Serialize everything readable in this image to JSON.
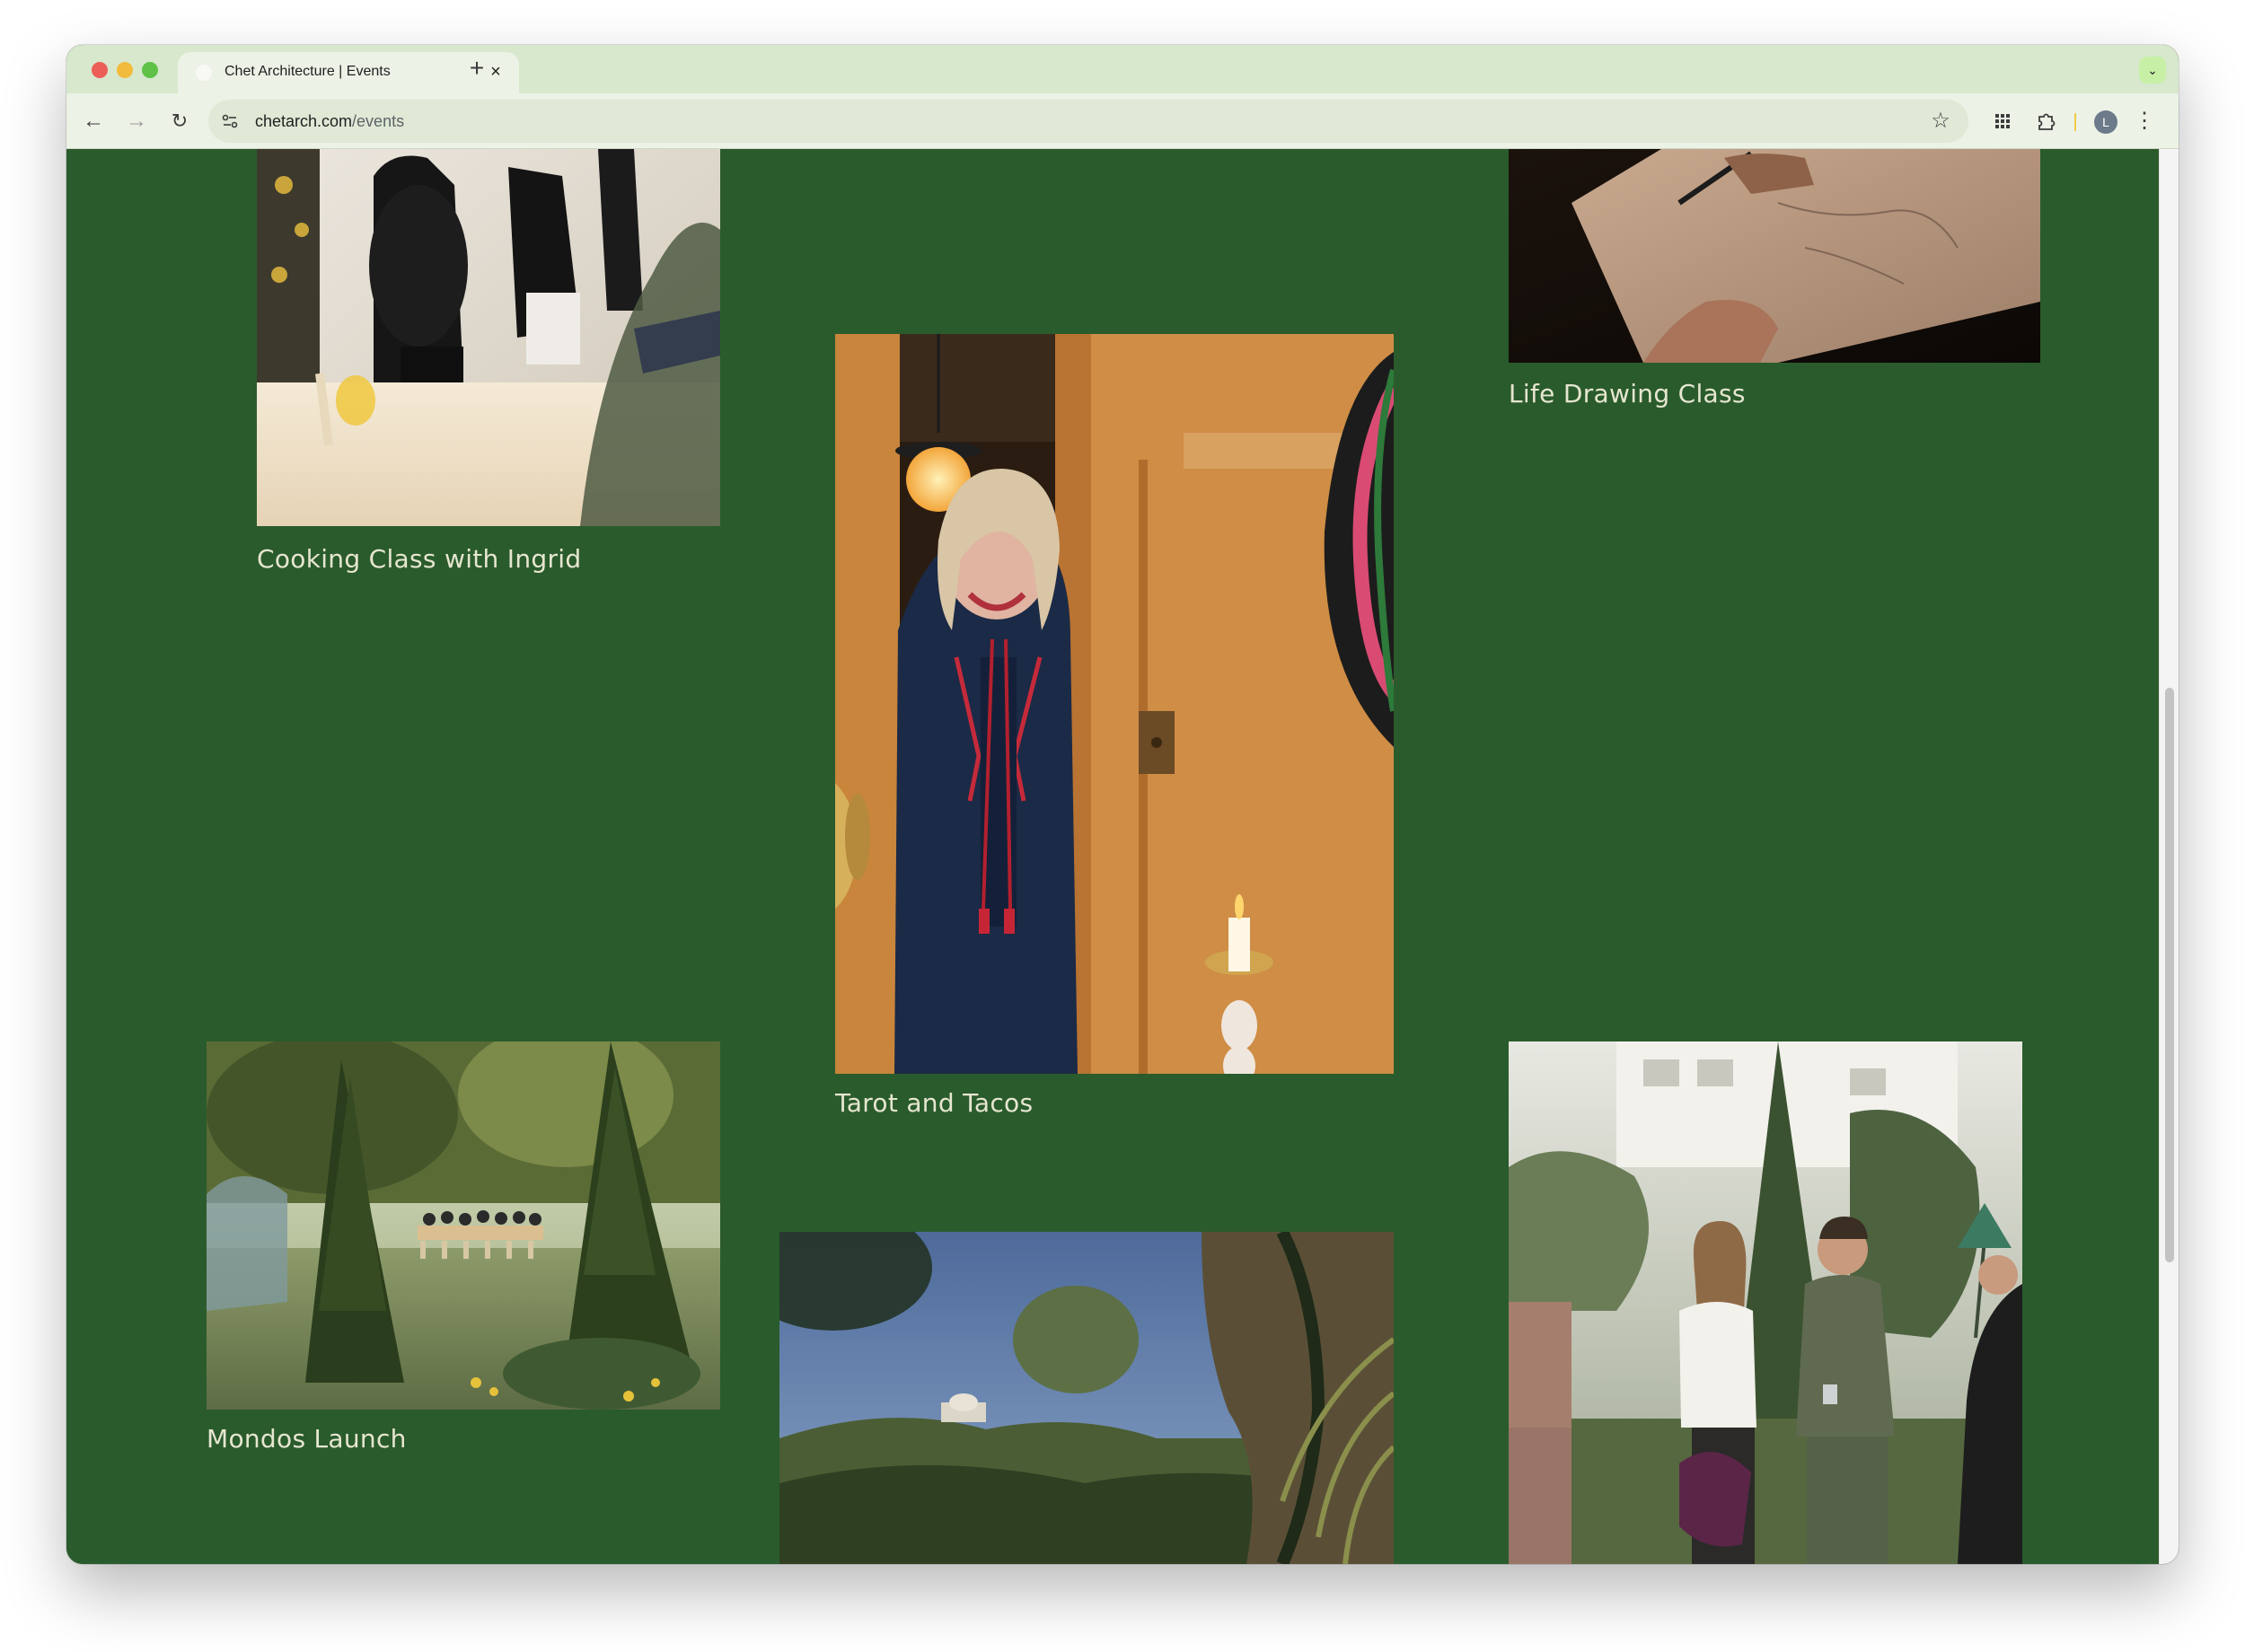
{
  "browser": {
    "tab_title": "Chet Architecture | Events",
    "url_host": "chetarch.com",
    "url_path": "/events",
    "avatar_initial": "L"
  },
  "icons": {
    "back": "back-arrow-icon",
    "forward": "forward-arrow-icon",
    "reload": "reload-icon",
    "site_info": "site-info-icon",
    "bookmark": "star-icon",
    "apps": "apps-grid-icon",
    "extensions": "puzzle-icon",
    "menu": "kebab-menu-icon",
    "close": "close-icon",
    "new_tab": "plus-icon",
    "tab_search": "chevron-down-icon"
  },
  "colors": {
    "page_background": "#2a5b2c",
    "caption_text": "#e6e6d0",
    "tab_strip": "#d7e8cd"
  },
  "events": [
    {
      "title": "Cooking Class with Ingrid"
    },
    {
      "title": "Tarot and Tacos"
    },
    {
      "title": "Life Drawing Class"
    },
    {
      "title": "Mondos Launch"
    },
    {
      "title": ""
    },
    {
      "title": ""
    }
  ]
}
